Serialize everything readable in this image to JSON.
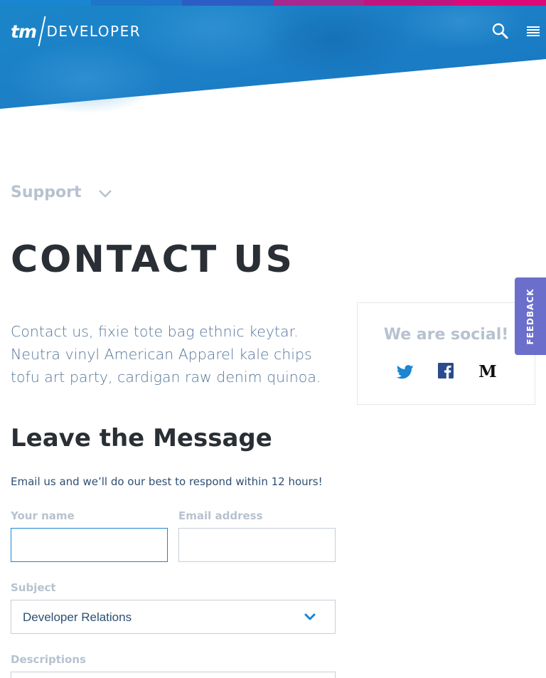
{
  "header": {
    "logo_mark": "tm",
    "logo_text": "DEVELOPER",
    "strip_colors": [
      "#1a85d1",
      "#1f75c9",
      "#2c5dc4",
      "#a7288f",
      "#c0157f",
      "#dc0a78"
    ],
    "hero_color": "#1680c6",
    "icons": {
      "search": "search-icon",
      "menu": "hamburger-menu-icon"
    }
  },
  "breadcrumb": {
    "label": "Support",
    "icon": "chevron-down-icon"
  },
  "page": {
    "title": "CONTACT US",
    "intro": "Contact us, fixie tote bag ethnic keytar. Neutra vinyl American Apparel kale chips tofu art party, cardigan raw denim quinoa."
  },
  "social": {
    "title": "We are social!",
    "icons": [
      "twitter-icon",
      "facebook-icon",
      "medium-icon"
    ]
  },
  "feedback": {
    "label": "FEEDBACK",
    "color": "#6b6fcb"
  },
  "form": {
    "title": "Leave the Message",
    "subtitle": "Email us and we’ll do our best to respond within 12 hours!",
    "name_label": "Your name",
    "name_value": "",
    "email_label": "Email address",
    "email_value": "",
    "subject_label": "Subject",
    "subject_value": "Developer Relations",
    "descriptions_label": "Descriptions"
  },
  "colors": {
    "accent": "#1a85d1",
    "heading": "#2a2e35",
    "muted": "#b7c2cf",
    "body_text": "#55769b"
  }
}
